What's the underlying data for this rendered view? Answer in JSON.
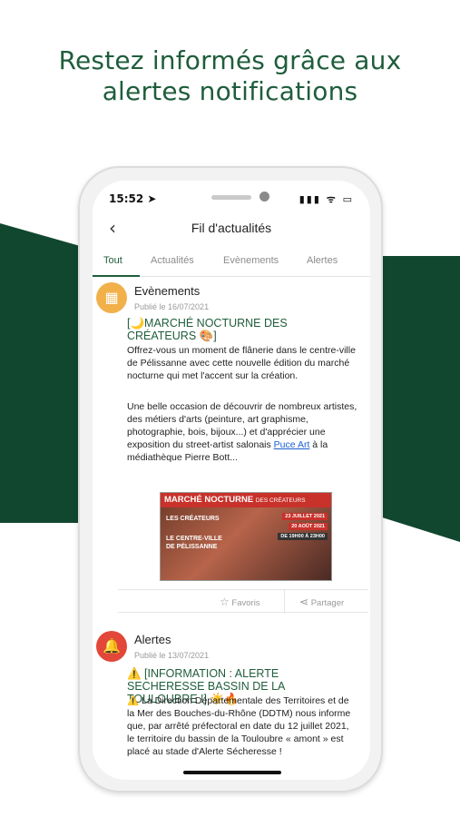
{
  "headline": {
    "line1": "Restez informés grâce aux",
    "line2": "alertes notifications"
  },
  "status": {
    "time": "15:52 ➤",
    "icons": "▮▮▮ ᯤ ▭"
  },
  "navbar": {
    "back_icon": "‹",
    "title": "Fil d'actualités"
  },
  "tabs": [
    {
      "label": "Tout",
      "active": true
    },
    {
      "label": "Actualités",
      "active": false
    },
    {
      "label": "Evènements",
      "active": false
    },
    {
      "label": "Alertes",
      "active": false
    }
  ],
  "post1": {
    "category": "Evènements",
    "date": "Publié le 16/07/2021",
    "title": "[🌙MARCHÉ NOCTURNE DES CRÉATEURS 🎨]",
    "para1": "Offrez-vous un moment de flânerie dans le centre-ville de Pélissanne avec cette nouvelle édition du marché nocturne qui met l'accent sur la création.",
    "para2_a": "Une belle occasion de découvrir de nombreux artistes, des métiers d'arts (peinture, art graphisme, photographie, bois, bijoux...) et d'apprécier une exposition du street-artist salonais ",
    "para2_link": "Puce Art",
    "para2_b": " à la médiathèque Pierre Bott...",
    "poster": {
      "title": "MARCHÉ NOCTURNE",
      "subtitle": "DES CRÉATEURS",
      "line1": "LES CRÉATEURS",
      "line2": "LE CENTRE-VILLE DE PÉLISSANNE",
      "date1": "23 JUILLET 2021",
      "date2": "20 AOÛT 2021",
      "time": "DE 19H00 À 23H00"
    },
    "actions": {
      "fav_icon": "☆",
      "fav": "Favoris",
      "share_icon": "⋖",
      "share": "Partager"
    }
  },
  "post2": {
    "category": "Alertes",
    "date": "Publié le 13/07/2021",
    "title": "⚠️ [INFORMATION : ALERTE SECHERESSE BASSIN DE LA TOULOUBRE !] ☀️🔥",
    "body": "⚠️ La Direction Départementale des Territoires et de la Mer des Bouches-du-Rhône (DDTM) nous informe que, par arrêté préfectoral en date du 12 juillet 2021, le territoire du bassin de la Touloubre « amont » est placé au stade d'Alerte Sécheresse !"
  },
  "colors": {
    "brand_green": "#1f5d3c",
    "band_green": "#11472f",
    "event_orange": "#f2b04a",
    "alert_red": "#e2473a"
  }
}
